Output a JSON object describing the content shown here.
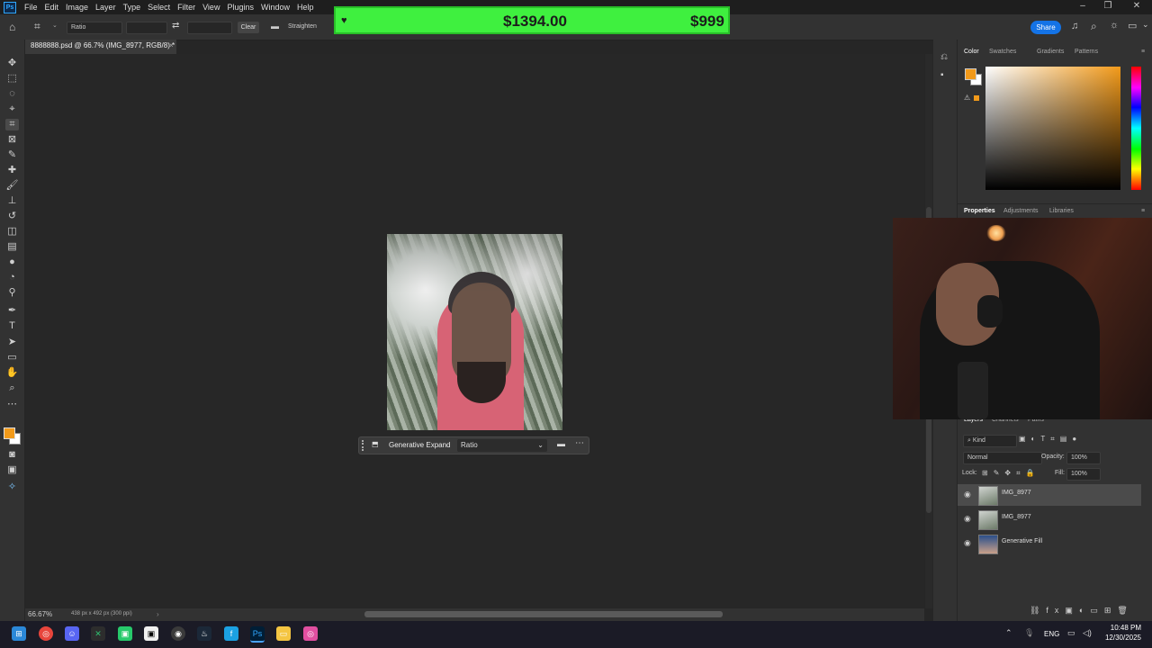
{
  "app": {
    "logo": "Ps"
  },
  "menu": [
    "File",
    "Edit",
    "Image",
    "Layer",
    "Type",
    "Select",
    "Filter",
    "View",
    "Plugins",
    "Window",
    "Help"
  ],
  "options": {
    "ratio_label": "Ratio",
    "clear_label": "Clear",
    "straighten_label": "Straighten",
    "share_label": "Share"
  },
  "banner": {
    "amount": "$1394.00",
    "goal": "$999",
    "color": "#3ff03f"
  },
  "document": {
    "tab_title": "8888888.psd @ 66.7% (IMG_8977, RGB/8) *"
  },
  "context_bar": {
    "action_label": "Generative Expand",
    "select_value": "Ratio"
  },
  "status": {
    "zoom": "66.67%",
    "doc_info": "438 px x 492 px (300 ppi)"
  },
  "color_panel": {
    "tabs": [
      "Color",
      "Swatches",
      "Gradients",
      "Patterns"
    ],
    "foreground": "#f29a1a",
    "background": "#ffffff"
  },
  "properties_panel": {
    "tabs": [
      "Properties",
      "Adjustments",
      "Libraries"
    ]
  },
  "layers_panel": {
    "tabs": [
      "Layers",
      "Channels",
      "Paths"
    ],
    "filter_label": "Kind",
    "blend_mode": "Normal",
    "opacity_label": "Opacity:",
    "opacity": "100%",
    "lock_label": "Lock:",
    "fill_label": "Fill:",
    "fill": "100%",
    "layers": [
      {
        "name": "IMG_8977",
        "selected": true
      },
      {
        "name": "IMG_8977",
        "selected": false
      },
      {
        "name": "Generative Fill",
        "selected": false
      }
    ]
  },
  "taskbar": {
    "lang": "ENG",
    "time": "10:48 PM",
    "date": "12/30/2025"
  }
}
